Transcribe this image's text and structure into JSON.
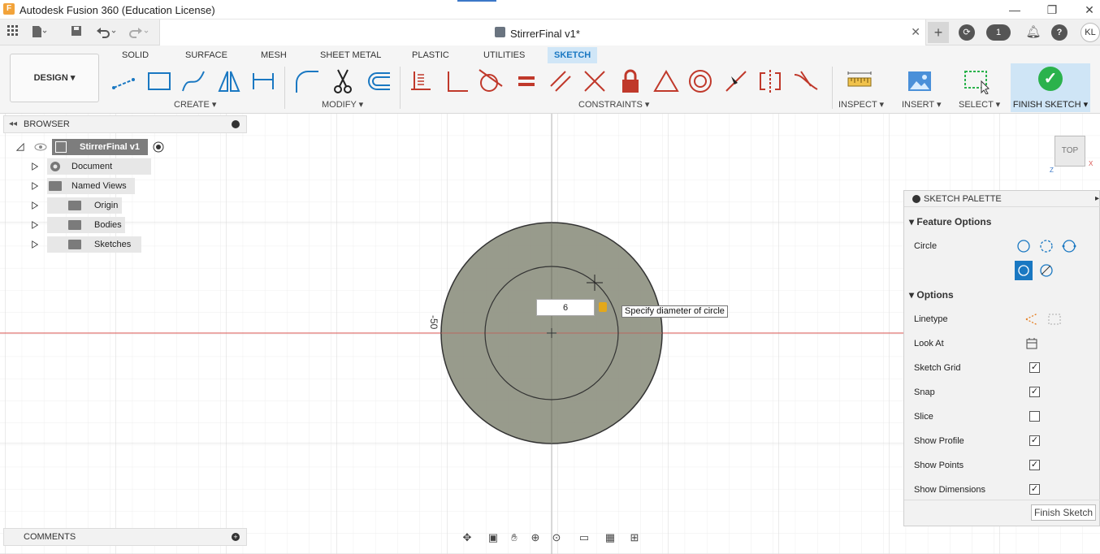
{
  "window": {
    "title": "Autodesk Fusion 360 (Education License)",
    "minimize": "—",
    "restore": "❐",
    "close": "✕"
  },
  "app_toolbar": {
    "document_title": "StirrerFinal v1*",
    "doc_close": "✕",
    "jobs_count": "1",
    "user_initials": "KL"
  },
  "ribbon": {
    "workspace": "DESIGN",
    "tabs": [
      "SOLID",
      "SURFACE",
      "MESH",
      "SHEET METAL",
      "PLASTIC",
      "UTILITIES",
      "SKETCH"
    ],
    "active_tab": "SKETCH",
    "groups": {
      "create": "CREATE",
      "modify": "MODIFY",
      "constraints": "CONSTRAINTS",
      "inspect": "INSPECT",
      "insert": "INSERT",
      "select": "SELECT",
      "finish": "FINISH SKETCH"
    }
  },
  "browser": {
    "title": "BROWSER",
    "root": "StirrerFinal v1",
    "items": [
      {
        "label": "Document Settings",
        "icon": "gear-icon"
      },
      {
        "label": "Named Views",
        "icon": "folder-icon"
      },
      {
        "label": "Origin",
        "icon": "folder-icon",
        "hidden": true
      },
      {
        "label": "Bodies",
        "icon": "folder-icon"
      },
      {
        "label": "Sketches",
        "icon": "folder-icon"
      }
    ]
  },
  "canvas": {
    "dimension_value": "6",
    "tooltip": "Specify diameter of circle",
    "dim_label": "-50",
    "view_cube": "TOP"
  },
  "palette": {
    "title": "SKETCH PALETTE",
    "feature_options": "Feature Options",
    "circle_label": "Circle",
    "options": "Options",
    "rows": [
      {
        "label": "Linetype",
        "type": "icons"
      },
      {
        "label": "Look At",
        "type": "icon"
      },
      {
        "label": "Sketch Grid",
        "checked": true
      },
      {
        "label": "Snap",
        "checked": true
      },
      {
        "label": "Slice",
        "checked": false
      },
      {
        "label": "Show Profile",
        "checked": true
      },
      {
        "label": "Show Points",
        "checked": true
      },
      {
        "label": "Show Dimensions",
        "checked": true
      }
    ],
    "finish_button": "Finish Sketch"
  },
  "comments": {
    "title": "COMMENTS"
  },
  "colors": {
    "accent": "#1a78c2",
    "profile_fill": "#8d9080",
    "finish_green": "#2bb24c",
    "axis_red": "#d9534f"
  }
}
